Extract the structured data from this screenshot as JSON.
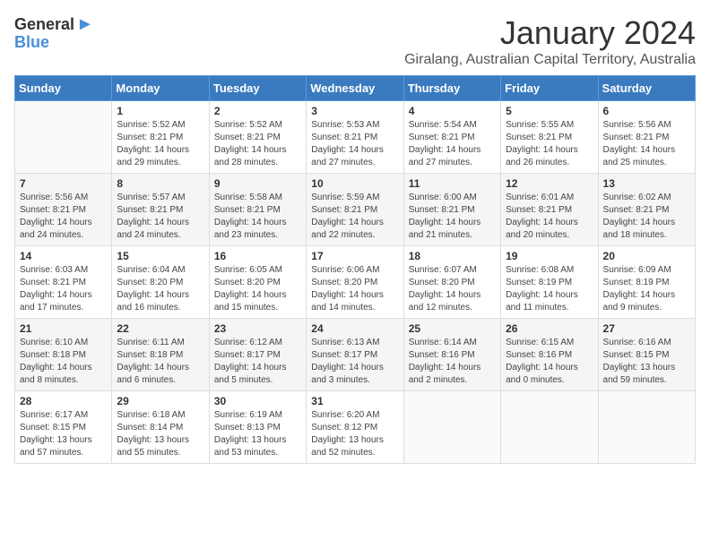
{
  "logo": {
    "general": "General",
    "blue": "Blue",
    "arrow": "▶"
  },
  "title": "January 2024",
  "location": "Giralang, Australian Capital Territory, Australia",
  "days_of_week": [
    "Sunday",
    "Monday",
    "Tuesday",
    "Wednesday",
    "Thursday",
    "Friday",
    "Saturday"
  ],
  "weeks": [
    [
      {
        "day": "",
        "info": ""
      },
      {
        "day": "1",
        "info": "Sunrise: 5:52 AM\nSunset: 8:21 PM\nDaylight: 14 hours\nand 29 minutes."
      },
      {
        "day": "2",
        "info": "Sunrise: 5:52 AM\nSunset: 8:21 PM\nDaylight: 14 hours\nand 28 minutes."
      },
      {
        "day": "3",
        "info": "Sunrise: 5:53 AM\nSunset: 8:21 PM\nDaylight: 14 hours\nand 27 minutes."
      },
      {
        "day": "4",
        "info": "Sunrise: 5:54 AM\nSunset: 8:21 PM\nDaylight: 14 hours\nand 27 minutes."
      },
      {
        "day": "5",
        "info": "Sunrise: 5:55 AM\nSunset: 8:21 PM\nDaylight: 14 hours\nand 26 minutes."
      },
      {
        "day": "6",
        "info": "Sunrise: 5:56 AM\nSunset: 8:21 PM\nDaylight: 14 hours\nand 25 minutes."
      }
    ],
    [
      {
        "day": "7",
        "info": "Sunrise: 5:56 AM\nSunset: 8:21 PM\nDaylight: 14 hours\nand 24 minutes."
      },
      {
        "day": "8",
        "info": "Sunrise: 5:57 AM\nSunset: 8:21 PM\nDaylight: 14 hours\nand 24 minutes."
      },
      {
        "day": "9",
        "info": "Sunrise: 5:58 AM\nSunset: 8:21 PM\nDaylight: 14 hours\nand 23 minutes."
      },
      {
        "day": "10",
        "info": "Sunrise: 5:59 AM\nSunset: 8:21 PM\nDaylight: 14 hours\nand 22 minutes."
      },
      {
        "day": "11",
        "info": "Sunrise: 6:00 AM\nSunset: 8:21 PM\nDaylight: 14 hours\nand 21 minutes."
      },
      {
        "day": "12",
        "info": "Sunrise: 6:01 AM\nSunset: 8:21 PM\nDaylight: 14 hours\nand 20 minutes."
      },
      {
        "day": "13",
        "info": "Sunrise: 6:02 AM\nSunset: 8:21 PM\nDaylight: 14 hours\nand 18 minutes."
      }
    ],
    [
      {
        "day": "14",
        "info": "Sunrise: 6:03 AM\nSunset: 8:21 PM\nDaylight: 14 hours\nand 17 minutes."
      },
      {
        "day": "15",
        "info": "Sunrise: 6:04 AM\nSunset: 8:20 PM\nDaylight: 14 hours\nand 16 minutes."
      },
      {
        "day": "16",
        "info": "Sunrise: 6:05 AM\nSunset: 8:20 PM\nDaylight: 14 hours\nand 15 minutes."
      },
      {
        "day": "17",
        "info": "Sunrise: 6:06 AM\nSunset: 8:20 PM\nDaylight: 14 hours\nand 14 minutes."
      },
      {
        "day": "18",
        "info": "Sunrise: 6:07 AM\nSunset: 8:20 PM\nDaylight: 14 hours\nand 12 minutes."
      },
      {
        "day": "19",
        "info": "Sunrise: 6:08 AM\nSunset: 8:19 PM\nDaylight: 14 hours\nand 11 minutes."
      },
      {
        "day": "20",
        "info": "Sunrise: 6:09 AM\nSunset: 8:19 PM\nDaylight: 14 hours\nand 9 minutes."
      }
    ],
    [
      {
        "day": "21",
        "info": "Sunrise: 6:10 AM\nSunset: 8:18 PM\nDaylight: 14 hours\nand 8 minutes."
      },
      {
        "day": "22",
        "info": "Sunrise: 6:11 AM\nSunset: 8:18 PM\nDaylight: 14 hours\nand 6 minutes."
      },
      {
        "day": "23",
        "info": "Sunrise: 6:12 AM\nSunset: 8:17 PM\nDaylight: 14 hours\nand 5 minutes."
      },
      {
        "day": "24",
        "info": "Sunrise: 6:13 AM\nSunset: 8:17 PM\nDaylight: 14 hours\nand 3 minutes."
      },
      {
        "day": "25",
        "info": "Sunrise: 6:14 AM\nSunset: 8:16 PM\nDaylight: 14 hours\nand 2 minutes."
      },
      {
        "day": "26",
        "info": "Sunrise: 6:15 AM\nSunset: 8:16 PM\nDaylight: 14 hours\nand 0 minutes."
      },
      {
        "day": "27",
        "info": "Sunrise: 6:16 AM\nSunset: 8:15 PM\nDaylight: 13 hours\nand 59 minutes."
      }
    ],
    [
      {
        "day": "28",
        "info": "Sunrise: 6:17 AM\nSunset: 8:15 PM\nDaylight: 13 hours\nand 57 minutes."
      },
      {
        "day": "29",
        "info": "Sunrise: 6:18 AM\nSunset: 8:14 PM\nDaylight: 13 hours\nand 55 minutes."
      },
      {
        "day": "30",
        "info": "Sunrise: 6:19 AM\nSunset: 8:13 PM\nDaylight: 13 hours\nand 53 minutes."
      },
      {
        "day": "31",
        "info": "Sunrise: 6:20 AM\nSunset: 8:12 PM\nDaylight: 13 hours\nand 52 minutes."
      },
      {
        "day": "",
        "info": ""
      },
      {
        "day": "",
        "info": ""
      },
      {
        "day": "",
        "info": ""
      }
    ]
  ]
}
